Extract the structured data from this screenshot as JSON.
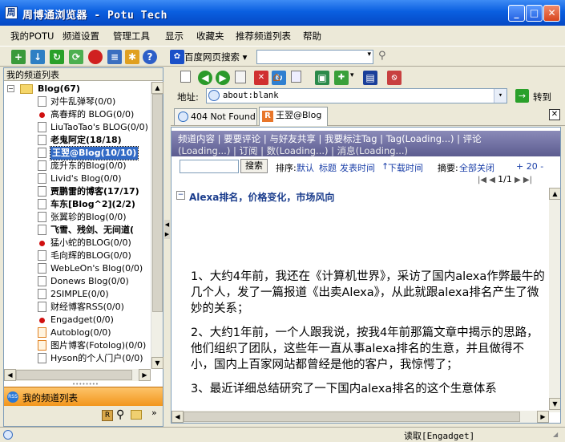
{
  "window": {
    "title": "周博通浏览器 - Potu Tech",
    "app_icon_glyph": "周"
  },
  "menu": [
    "我的POTU",
    "频道设置",
    "管理工具",
    "显示",
    "收藏夹",
    "推荐频道列表",
    "帮助"
  ],
  "search": {
    "engine": "百度网页搜索",
    "value": ""
  },
  "left_panel": {
    "header": "我的频道列表",
    "root": "Blog(67)",
    "items": [
      {
        "label": "对牛乱弹琴(0/0)",
        "icon": "doc",
        "bold": false
      },
      {
        "label": "高春辉的 BLOG(0/0)",
        "icon": "dot",
        "bold": false
      },
      {
        "label": "LiuTaoTao's BLOG(0/0)",
        "icon": "doc",
        "bold": false
      },
      {
        "label": "老鬼阿定(18/18)",
        "icon": "doc",
        "bold": true
      },
      {
        "label": "王翌@Blog(10/10)",
        "icon": "doc",
        "bold": true,
        "selected": true
      },
      {
        "label": "庞升东的Blog(0/0)",
        "icon": "doc",
        "bold": false
      },
      {
        "label": "Livid's Blog(0/0)",
        "icon": "doc",
        "bold": false
      },
      {
        "label": "贾鹏雷的博客(17/17)",
        "icon": "doc",
        "bold": true
      },
      {
        "label": "车东[Blog^2](2/2)",
        "icon": "doc",
        "bold": true
      },
      {
        "label": "张翼轸的Blog(0/0)",
        "icon": "doc",
        "bold": false
      },
      {
        "label": "飞雪、残剑、无间道(",
        "icon": "doc",
        "bold": true
      },
      {
        "label": "猛小蛇的BLOG(0/0)",
        "icon": "dot",
        "bold": false
      },
      {
        "label": "毛向辉的BLOG(0/0)",
        "icon": "doc",
        "bold": false
      },
      {
        "label": "WebLeOn's Blog(0/0)",
        "icon": "doc",
        "bold": false
      },
      {
        "label": "Donews Blog(0/0)",
        "icon": "doc",
        "bold": false
      },
      {
        "label": "2SIMPLE(0/0)",
        "icon": "doc",
        "bold": false
      },
      {
        "label": "财经博客RSS(0/0)",
        "icon": "doc",
        "bold": false
      },
      {
        "label": "Engadget(0/0)",
        "icon": "dot",
        "bold": false
      },
      {
        "label": "Autoblog(0/0)",
        "icon": "orange",
        "bold": false
      },
      {
        "label": "图片博客(Fotolog)(0/0)",
        "icon": "orange",
        "bold": false
      },
      {
        "label": "Hyson的个人门户(0/0)",
        "icon": "doc",
        "bold": false
      }
    ],
    "footer_label": "我的频道列表"
  },
  "address": {
    "label": "地址:",
    "value": "about:blank",
    "go_label": "转到"
  },
  "tabs": [
    {
      "label": "404 Not Found",
      "active": false
    },
    {
      "label": "王翌@Blog",
      "active": true
    }
  ],
  "content": {
    "nav_line1": "频道内容 | 要要评论 | 与好友共享 | 我要标注Tag | Tag(Loading...) | 评论",
    "nav_line2": "(Loading...) | 订阅 | 数(Loading...) | 消息(Loading...)",
    "search_button": "搜索",
    "sort_label": "排序:",
    "sort_options": [
      "默认",
      "标题",
      "发表时间",
      "下载时间"
    ],
    "summary_label": "摘要:",
    "summary_value": "全部关闭",
    "page_size": "+ 20 -",
    "pager": "1/1",
    "article_title": "Alexa排名，价格变化，市场风向",
    "paragraphs": [
      "1、大约4年前，我还在《计算机世界》，采访了国内alexa作弊最牛的几个人，发了一篇报道《出卖Alexa》，从此就跟alexa排名产生了微妙的关系；",
      "2、大约1年前，一个人跟我说，按我4年前那篇文章中揭示的思路，他们组织了团队，这些年一直从事alexa排名的生意，并且做得不小，国内上百家网站都曾经是他的客户，我惊愕了；",
      "3、最近详细总结研究了一下国内alexa排名的这个生意体系"
    ]
  },
  "status": {
    "text": "读取[Engadget]"
  }
}
